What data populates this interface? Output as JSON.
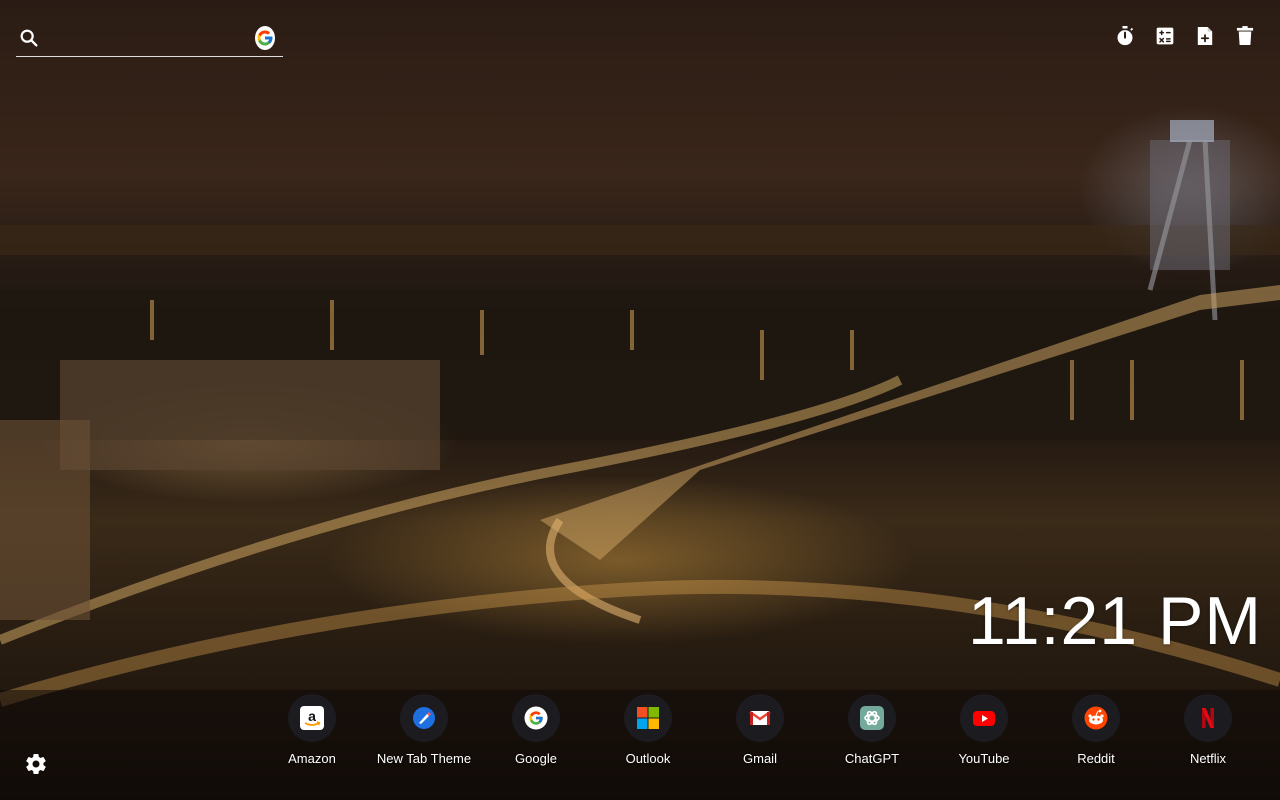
{
  "search": {
    "placeholder": "",
    "value": "",
    "engine_icon": "google-icon"
  },
  "toolbar": {
    "items": [
      {
        "icon": "timer-icon"
      },
      {
        "icon": "calculator-icon"
      },
      {
        "icon": "add-file-icon"
      },
      {
        "icon": "trash-icon"
      }
    ]
  },
  "clock": {
    "time": "11:21 PM"
  },
  "shortcuts": [
    {
      "label": "Amazon",
      "icon": "amazon-icon",
      "color": "#ffffff"
    },
    {
      "label": "New Tab Theme",
      "icon": "new-tab-theme-icon",
      "color": "#1e6fe0"
    },
    {
      "label": "Google",
      "icon": "google-icon",
      "color": "#ffffff"
    },
    {
      "label": "Outlook",
      "icon": "microsoft-icon",
      "color": "#f25022"
    },
    {
      "label": "Gmail",
      "icon": "gmail-icon",
      "color": "#ea4335"
    },
    {
      "label": "ChatGPT",
      "icon": "chatgpt-icon",
      "color": "#74aa9c"
    },
    {
      "label": "YouTube",
      "icon": "youtube-icon",
      "color": "#ff0000"
    },
    {
      "label": "Reddit",
      "icon": "reddit-icon",
      "color": "#ff4500"
    },
    {
      "label": "Netflix",
      "icon": "netflix-icon",
      "color": "#e50914"
    }
  ],
  "settings": {
    "icon": "gear-icon"
  }
}
